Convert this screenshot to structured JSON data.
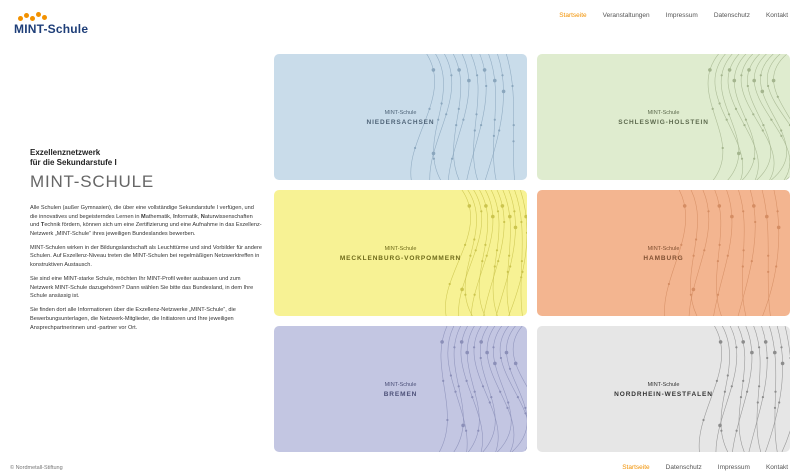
{
  "brand": {
    "logo_text": "MINT-Schule",
    "accent": "#f29100",
    "text_color": "#1e3e78"
  },
  "nav": {
    "items": [
      {
        "label": "Startseite",
        "active": true
      },
      {
        "label": "Veranstaltungen",
        "active": false
      },
      {
        "label": "Impressum",
        "active": false
      },
      {
        "label": "Datenschutz",
        "active": false
      },
      {
        "label": "Kontakt",
        "active": false
      }
    ]
  },
  "intro": {
    "kicker_line1": "Exzellenznetzwerk",
    "kicker_line2": "für die Sekundarstufe I",
    "title": "MINT-SCHULE",
    "p1_a": "Alle Schulen (außer Gymnasien), die über eine vollständige Sekundarstufe I verfügen, und die innovatives und begeisterndes Lernen in ",
    "p1_m": "M",
    "p1_b": "athematik, ",
    "p1_i": "I",
    "p1_c": "nformatik, ",
    "p1_n": "N",
    "p1_d": "aturwissenschaften und ",
    "p1_t": "T",
    "p1_e": "echnik fördern, können sich um eine Zertifizierung und eine Aufnahme in das Exzellenz-Netzwerk „MINT-Schule“ ihres jeweiligen Bundeslandes bewerben.",
    "p2": "MINT-Schulen wirken in der Bildungslandschaft als Leuchttürme und sind Vorbilder für andere Schulen. Auf Exzellenz-Niveau treten die MINT-Schulen bei regelmäßigen Netzwerktreffen in konstruktiven Austausch.",
    "p3": "Sie sind eine MINT-starke Schule, möchten Ihr MINT-Profil weiter ausbauen und zum Netzwerk MINT-Schule dazugehören? Dann wählen Sie bitte das Bundesland, in dem Ihre Schule ansässig ist.",
    "p4": "Sie finden dort alle Informationen über die Exzellenz-Netzwerke „MINT-Schule“, die Bewerbungsunterlagen, die Netzwerk-Mitglieder, die Initiatoren und Ihre jeweiligen Ansprechpartnerinnen und -partner vor Ort."
  },
  "tiles": [
    {
      "small": "MINT-Schule",
      "region": "NIEDERSACHSEN",
      "bg": "#c9dcea",
      "line": "#8aa6bd",
      "text": "#4f6478"
    },
    {
      "small": "MINT-Schule",
      "region": "SCHLESWIG-HOLSTEIN",
      "bg": "#dfeccf",
      "line": "#a4b58e",
      "text": "#5d6a4e"
    },
    {
      "small": "MINT-Schule",
      "region": "MECKLENBURG-VORPOMMERN",
      "bg": "#f7f294",
      "line": "#cbc44e",
      "text": "#6e6a1a"
    },
    {
      "small": "MINT-Schule",
      "region": "HAMBURG",
      "bg": "#f3b590",
      "line": "#d58d63",
      "text": "#805032"
    },
    {
      "small": "MINT-Schule",
      "region": "BREMEN",
      "bg": "#c3c6e2",
      "line": "#8b8fb8",
      "text": "#4c5078"
    },
    {
      "small": "MINT-Schule",
      "region": "NORDRHEIN-WESTFALEN",
      "bg": "#e6e6e6",
      "line": "#8c8c8c",
      "text": "#333333"
    }
  ],
  "footer": {
    "copyright": "© Nordmetall-Stiftung",
    "nav": [
      {
        "label": "Startseite",
        "active": true
      },
      {
        "label": "Datenschutz",
        "active": false
      },
      {
        "label": "Impressum",
        "active": false
      },
      {
        "label": "Kontakt",
        "active": false
      }
    ]
  }
}
